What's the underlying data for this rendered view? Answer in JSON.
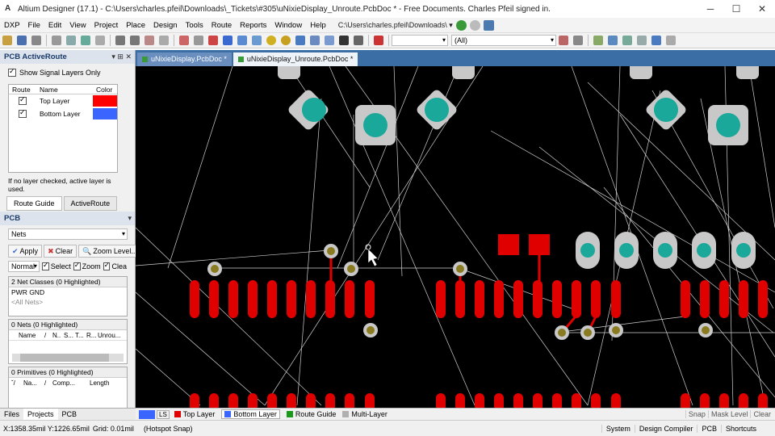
{
  "window": {
    "title": "Altium Designer (17.1) - C:\\Users\\charles.pfeil\\Downloads\\_Tickets\\#305\\uNixieDisplay_Unroute.PcbDoc * - Free Documents. Charles Pfeil signed in.",
    "controls": [
      "─",
      "☐",
      "✕"
    ]
  },
  "menu": {
    "items": [
      "DXP",
      "File",
      "Edit",
      "View",
      "Project",
      "Place",
      "Design",
      "Tools",
      "Route",
      "Reports",
      "Window",
      "Help"
    ],
    "path": "C:\\Users\\charles.pfeil\\Downloads\\ ▾"
  },
  "toolbar": {
    "filter_all": "(All)"
  },
  "left_panel": {
    "active_route_title": "PCB ActiveRoute",
    "show_signal_layers_label": "Show Signal Layers Only",
    "route_col": "Route",
    "name_col": "Name",
    "color_col": "Color",
    "layers": [
      {
        "name": "Top Layer",
        "color": "#ff0000"
      },
      {
        "name": "Bottom Layer",
        "color": "#3a66ff"
      }
    ],
    "note": "If no layer checked, active layer is used.",
    "tab_route_guide": "Route Guide",
    "tab_active_route": "ActiveRoute",
    "pcb_title": "PCB",
    "nets_select": "Nets",
    "apply_label": "Apply",
    "clear_label": "Clear",
    "zoom_level_label": "Zoom Level...",
    "mode_select": "Normal",
    "select_label": "Select",
    "zoom_label": "Zoom",
    "clear2_label": "Clea",
    "net_classes_header": "2 Net Classes (0 Highlighted)",
    "net_classes": [
      "PWR GND",
      "<All Nets>"
    ],
    "nets_header": "0 Nets (0 Highlighted)",
    "nets_cols": [
      "Name",
      "/",
      "N..",
      "S...",
      "T...",
      "R...",
      "Unrou..."
    ],
    "primitives_header": "0 Primitives (0 Highlighted)",
    "prim_cols": [
      "Na...",
      "/",
      "Comp...",
      "Length"
    ],
    "bottom_tabs": [
      "Files",
      "Projects",
      "PCB"
    ]
  },
  "doc_tabs": [
    "uNixieDisplay.PcbDoc *",
    "uNixieDisplay_Unroute.PcbDoc *"
  ],
  "layer_bar": {
    "ls": "LS",
    "layers": [
      {
        "name": "Top Layer",
        "color": "#e00000"
      },
      {
        "name": "Bottom Layer",
        "color": "#3a66ff"
      },
      {
        "name": "Route Guide",
        "color": "#1a9a1a"
      },
      {
        "name": "Multi-Layer",
        "color": "#b0b0b0"
      }
    ],
    "right": [
      "Snap",
      "Mask Level",
      "Clear"
    ]
  },
  "status": {
    "coords": "X:1358.35mil Y:1226.65mil",
    "grid": "Grid: 0.01mil",
    "snap": "(Hotspot Snap)",
    "right": [
      "System",
      "Design Compiler",
      "PCB",
      "Shortcuts"
    ]
  }
}
